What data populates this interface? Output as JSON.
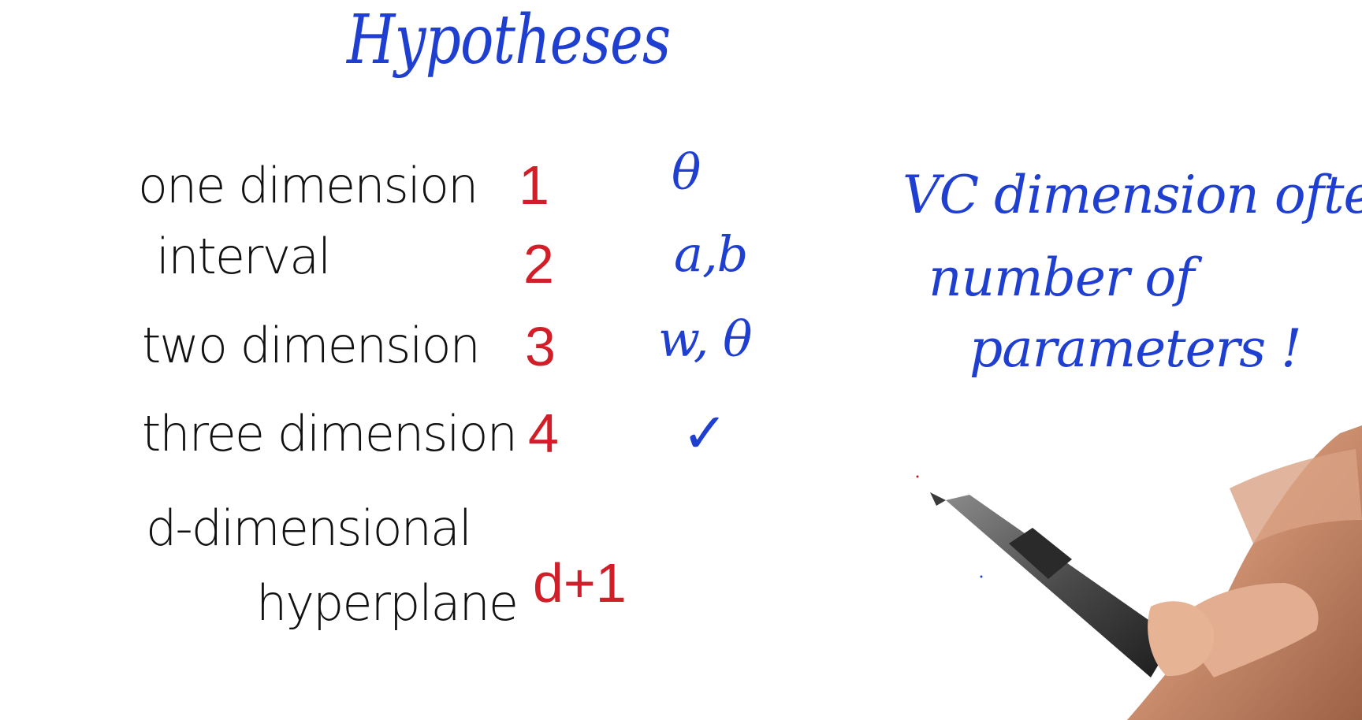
{
  "title": "Hypotheses",
  "rows": [
    {
      "label": "one dimension",
      "vc": "1",
      "params": "θ"
    },
    {
      "label": "interval",
      "vc": "2",
      "params": "a,b"
    },
    {
      "label": "two dimension",
      "vc": "3",
      "params": "w, θ"
    },
    {
      "label": "three dimension",
      "vc": "4",
      "params": "✓"
    },
    {
      "label_line1": "d-dimensional",
      "label_line2": "hyperplane",
      "vc": "d+1"
    }
  ],
  "note": {
    "line1": "VC dimension often",
    "line2": "number of",
    "line3": "parameters !"
  },
  "colors": {
    "labels": "#111111",
    "vc_values": "#d11e28",
    "parameters_and_title": "#1f3fd1"
  },
  "illustration": "hand-holding-pen"
}
